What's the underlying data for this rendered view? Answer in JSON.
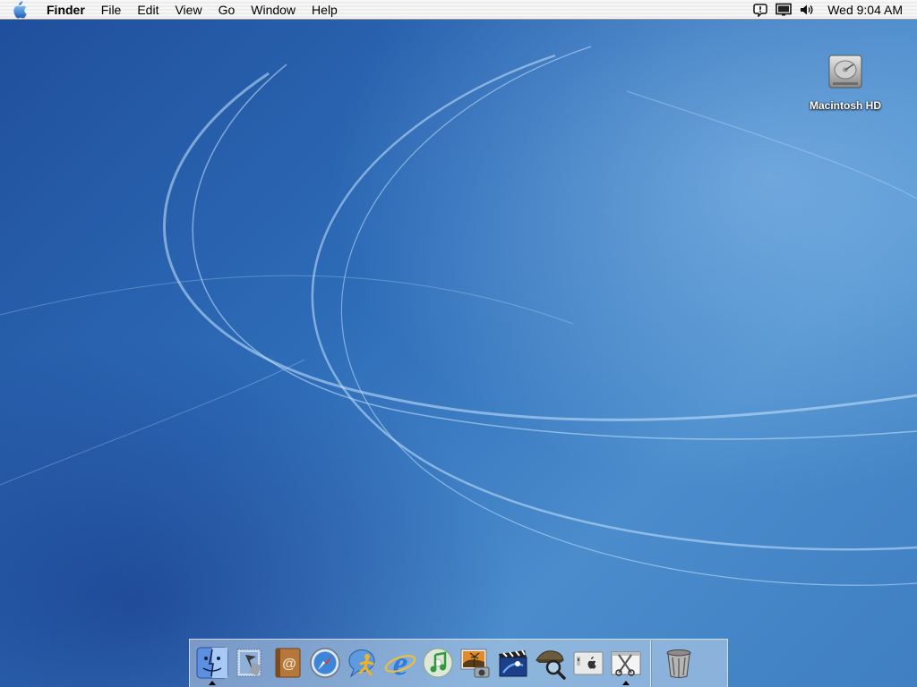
{
  "menubar": {
    "apple_icon": "apple-icon",
    "app_name": "Finder",
    "menus": [
      "File",
      "Edit",
      "View",
      "Go",
      "Window",
      "Help"
    ],
    "status_icons": [
      "alert-bubble-icon",
      "display-icon",
      "volume-icon"
    ],
    "clock": "Wed 9:04 AM"
  },
  "desktop": {
    "icons": [
      {
        "label": "Macintosh HD",
        "icon": "hard-drive-icon"
      }
    ]
  },
  "dock": {
    "apps": [
      {
        "icon": "finder-icon",
        "running": true
      },
      {
        "icon": "mail-icon",
        "running": false
      },
      {
        "icon": "address-book-icon",
        "running": false
      },
      {
        "icon": "safari-icon",
        "running": false
      },
      {
        "icon": "ichat-icon",
        "running": false
      },
      {
        "icon": "internet-explorer-icon",
        "running": false
      },
      {
        "icon": "itunes-icon",
        "running": false
      },
      {
        "icon": "iphoto-icon",
        "running": false
      },
      {
        "icon": "imovie-icon",
        "running": false
      },
      {
        "icon": "sherlock-icon",
        "running": false
      },
      {
        "icon": "system-preferences-icon",
        "running": false
      },
      {
        "icon": "grab-icon",
        "running": true
      }
    ],
    "trash": {
      "icon": "trash-icon"
    }
  },
  "colors": {
    "wallpaper": "#2e6cb8",
    "menubar": "#f2f2f2"
  }
}
